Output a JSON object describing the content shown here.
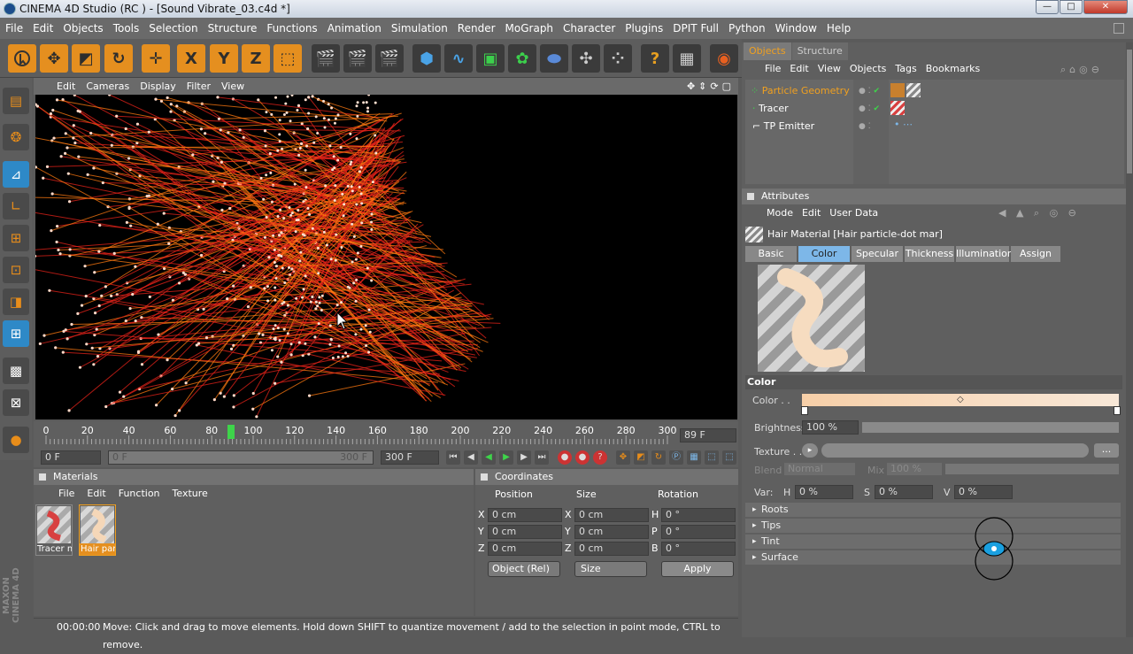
{
  "window": {
    "title": "CINEMA 4D Studio (RC ) - [Sound Vibrate_03.c4d *]",
    "min": "—",
    "max": "□",
    "close": "✕"
  },
  "menu": [
    "File",
    "Edit",
    "Objects",
    "Tools",
    "Selection",
    "Structure",
    "Functions",
    "Animation",
    "Simulation",
    "Render",
    "MoGraph",
    "Character",
    "Plugins",
    "DPIT Full",
    "Python",
    "Window",
    "Help"
  ],
  "toolbar": {
    "axis_x": "X",
    "axis_y": "Y",
    "axis_z": "Z"
  },
  "viewport": {
    "menu": [
      "Edit",
      "Cameras",
      "Display",
      "Filter",
      "View"
    ]
  },
  "timeline": {
    "ticks": [
      "0",
      "20",
      "40",
      "60",
      "80",
      "100",
      "120",
      "140",
      "160",
      "180",
      "200",
      "220",
      "240",
      "260",
      "280",
      "300"
    ],
    "current_frame": "89 F",
    "start": "0 F",
    "range_start": "0 F",
    "range_end": "300 F",
    "end": "300 F"
  },
  "materials": {
    "title": "Materials",
    "menu": [
      "File",
      "Edit",
      "Function",
      "Texture"
    ],
    "items": [
      "Tracer m",
      "Hair parti"
    ]
  },
  "coordinates": {
    "title": "Coordinates",
    "headers": [
      "Position",
      "Size",
      "Rotation"
    ],
    "rows": [
      {
        "a": "X",
        "pos": "0 cm",
        "b": "X",
        "size": "0 cm",
        "c": "H",
        "rot": "0 °"
      },
      {
        "a": "Y",
        "pos": "0 cm",
        "b": "Y",
        "size": "0 cm",
        "c": "P",
        "rot": "0 °"
      },
      {
        "a": "Z",
        "pos": "0 cm",
        "b": "Z",
        "size": "0 cm",
        "c": "B",
        "rot": "0 °"
      }
    ],
    "mode": "Object (Rel)",
    "size_mode": "Size",
    "apply": "Apply"
  },
  "status": {
    "time": "00:00:00",
    "message": "Move: Click and drag to move elements. Hold down SHIFT to quantize movement / add to the selection in point mode, CTRL to remove."
  },
  "objects": {
    "tabs": [
      "Objects",
      "Structure"
    ],
    "menu": [
      "File",
      "Edit",
      "View",
      "Objects",
      "Tags",
      "Bookmarks"
    ],
    "items": [
      "Particle Geometry",
      "Tracer",
      "TP Emitter"
    ]
  },
  "attributes": {
    "title": "Attributes",
    "menu": [
      "Mode",
      "Edit",
      "User Data"
    ],
    "material_name": "Hair Material [Hair particle-dot mar]",
    "tabs": [
      "Basic",
      "Color",
      "Specular",
      "Thickness",
      "Illumination",
      "Assign"
    ],
    "active_tab": "Color",
    "section": "Color",
    "color_label": "Color . .",
    "brightness_label": "Brightness",
    "brightness": "100 %",
    "brightness_level": 1.0,
    "texture_label": "Texture . .",
    "texture_btn": "...",
    "blend_label": "Blend",
    "blend_value": "Normal",
    "mix_label": "Mix",
    "mix_value": "100 %",
    "var_label": "Var:",
    "var_h_label": "H",
    "var_h": "0 %",
    "var_s_label": "S",
    "var_s": "0 %",
    "var_v_label": "V",
    "var_v": "0 %",
    "groups": [
      "Roots",
      "Tips",
      "Tint",
      "Surface"
    ]
  },
  "brand": "MAXON CINEMA 4D",
  "colors": {
    "accent": "#e58f1f",
    "selection_blue": "#7db7e8",
    "hair_red": "#e8231a",
    "hair_orange": "#ff7a10"
  }
}
